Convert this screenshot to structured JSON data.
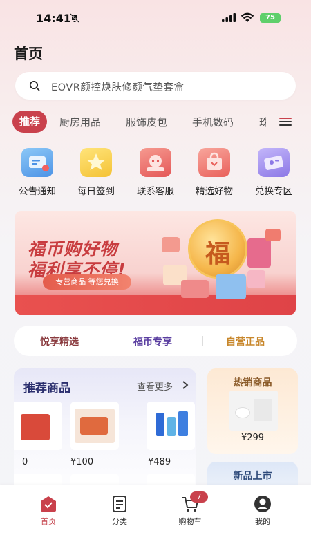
{
  "status_bar": {
    "time": "14:41",
    "battery": "75"
  },
  "page": {
    "title": "首页"
  },
  "search": {
    "text": "EOVR颜控焕肤修颜气垫套盒"
  },
  "tabs": [
    {
      "label": "推荐",
      "active": true
    },
    {
      "label": "厨房用品"
    },
    {
      "label": "服饰皮包"
    },
    {
      "label": "手机数码"
    },
    {
      "label": "珠"
    }
  ],
  "quick_links": [
    {
      "label": "公告通知",
      "icon": "announcement-icon",
      "color": "#5aa0e8"
    },
    {
      "label": "每日签到",
      "icon": "star-icon",
      "color": "#f4c43b"
    },
    {
      "label": "联系客服",
      "icon": "customer-service-icon",
      "color": "#e86060"
    },
    {
      "label": "精选好物",
      "icon": "shopping-bag-icon",
      "color": "#ec6b68"
    },
    {
      "label": "兑换专区",
      "icon": "ticket-icon",
      "color": "#8c7ee8"
    }
  ],
  "banner": {
    "line1": "福币购好物",
    "line2": "福利享不停!",
    "pill": "专营商品  等您兑换",
    "coin_char": "福"
  },
  "feature_tabs": [
    {
      "label": "悦享精选",
      "color": "#8a3b3f"
    },
    {
      "label": "福币专享",
      "color": "#5a3ea0"
    },
    {
      "label": "自营正品",
      "color": "#c8872c"
    }
  ],
  "recommend": {
    "title": "推荐商品",
    "more": "查看更多",
    "products": [
      {
        "price": "0"
      },
      {
        "price": "¥100"
      },
      {
        "price": "¥489"
      }
    ]
  },
  "hot": {
    "title": "热销商品",
    "price": "¥299"
  },
  "new_arrivals": {
    "title": "新品上市"
  },
  "bottom_nav": [
    {
      "label": "首页",
      "active": true
    },
    {
      "label": "分类"
    },
    {
      "label": "购物车"
    },
    {
      "label": "我的"
    }
  ],
  "cart_count": "7",
  "colors": {
    "accent": "#c9414c"
  }
}
